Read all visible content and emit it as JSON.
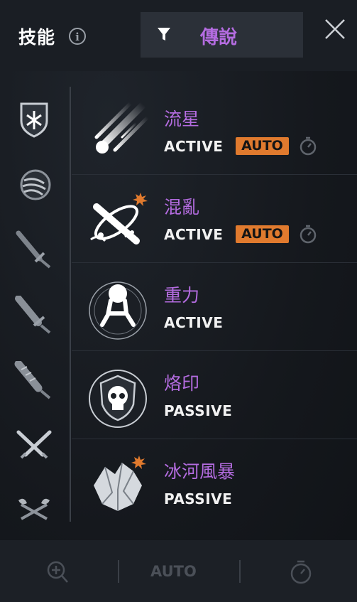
{
  "header": {
    "title": "技能",
    "info_icon": "info-icon",
    "filter": {
      "icon": "filter-icon",
      "label": "傳說"
    },
    "close_icon": "close-icon"
  },
  "sidebar": {
    "items": [
      {
        "icon": "shield-icon",
        "active": true
      },
      {
        "icon": "claw-icon",
        "active": false
      },
      {
        "icon": "sword-icon",
        "active": false
      },
      {
        "icon": "broadsword-icon",
        "active": false
      },
      {
        "icon": "spiked-club-icon",
        "active": false
      },
      {
        "icon": "crossed-swords-icon",
        "active": false
      },
      {
        "icon": "crossed-axes-icon",
        "active": false
      }
    ]
  },
  "skills": [
    {
      "name": "流星",
      "type": "ACTIVE",
      "auto": "AUTO",
      "icon": "meteor-icon",
      "timer_icon": "timer-icon"
    },
    {
      "name": "混亂",
      "type": "ACTIVE",
      "auto": "AUTO",
      "icon": "chaos-icon",
      "timer_icon": "timer-icon"
    },
    {
      "name": "重力",
      "type": "ACTIVE",
      "icon": "gravity-icon"
    },
    {
      "name": "烙印",
      "type": "PASSIVE",
      "icon": "brand-skull-icon"
    },
    {
      "name": "冰河風暴",
      "type": "PASSIVE",
      "icon": "glacier-storm-icon"
    }
  ],
  "bottom_bar": {
    "zoom_icon": "zoom-in-icon",
    "auto_label": "AUTO",
    "timer_icon": "timer-icon"
  },
  "colors": {
    "accent_purple": "#b46ce0",
    "auto_orange": "#e07a2e",
    "background": "#15181d"
  }
}
